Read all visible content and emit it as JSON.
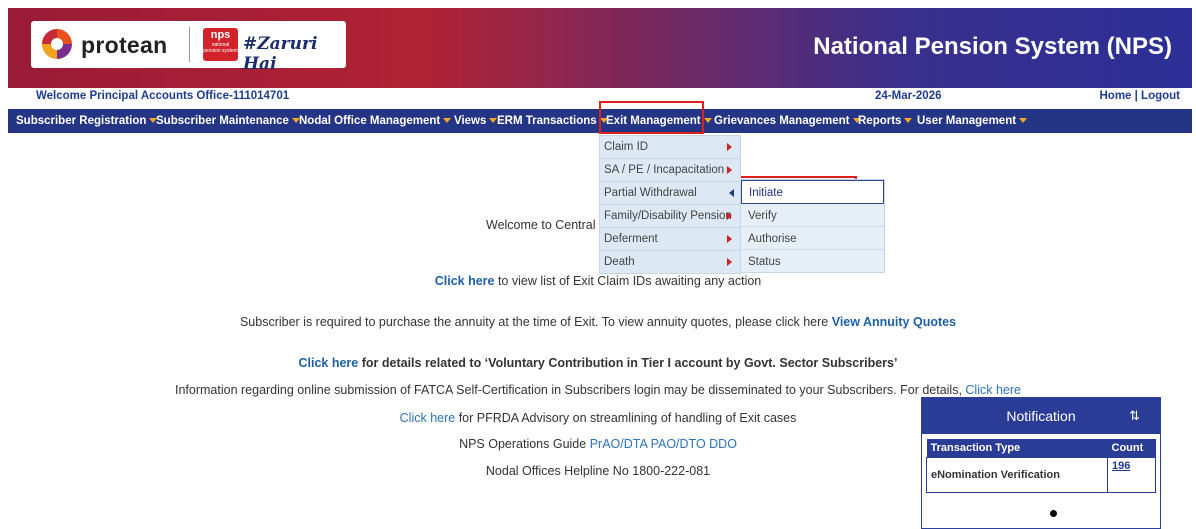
{
  "header": {
    "logo_text": "protean",
    "nps_badge": "nps",
    "nps_badge_small": "national pension system",
    "tagline": "#Zaruri Hai",
    "site_title": "National Pension System (NPS)"
  },
  "welcome": {
    "text": "Welcome Principal Accounts Office-111014701",
    "date": "24-Mar-2026",
    "home": "Home",
    "separator": " | ",
    "logout": "Logout"
  },
  "menu": [
    {
      "label": "Subscriber Registration"
    },
    {
      "label": "Subscriber Maintenance"
    },
    {
      "label": "Nodal Office Management"
    },
    {
      "label": "Views"
    },
    {
      "label": "ERM Transactions"
    },
    {
      "label": "Exit Management"
    },
    {
      "label": "Grievances Management"
    },
    {
      "label": "Reports"
    },
    {
      "label": "User Management"
    }
  ],
  "exit_dropdown": [
    {
      "label": "Claim ID"
    },
    {
      "label": "SA / PE / Incapacitation"
    },
    {
      "label": "Partial Withdrawal"
    },
    {
      "label": "Family/Disability Pension"
    },
    {
      "label": "Deferment"
    },
    {
      "label": "Death"
    }
  ],
  "partial_submenu": [
    {
      "label": "Initiate"
    },
    {
      "label": "Verify"
    },
    {
      "label": "Authorise"
    },
    {
      "label": "Status"
    }
  ],
  "content": {
    "welcome_partial": "Welcome to Central",
    "line1_link": "Click here",
    "line1_text": " to view list of Exit Claim IDs awaiting any action",
    "line2_text": "Subscriber is required to purchase the annuity at the time of Exit. To view annuity quotes, please click here ",
    "line2_link": "View Annuity Quotes",
    "line3_link": "Click here",
    "line3_text": " for details related to ‘Voluntary Contribution in Tier I account by Govt. Sector Subscribers’",
    "line4_text": "Information regarding online submission of FATCA Self-Certification in Subscribers login may be disseminated to your Subscribers. For details, ",
    "line4_link": "Click here",
    "line5_link": "Click here",
    "line5_text": " for PFRDA Advisory on streamlining of handling of Exit cases",
    "line6_text": "NPS Operations Guide ",
    "line6_link": "PrAO/DTA PAO/DTO DDO",
    "line7_text": "Nodal Offices Helpline No 1800-222-081"
  },
  "notification": {
    "title": "Notification",
    "sort_icon": "⇅",
    "col_type": "Transaction Type",
    "col_count": "Count",
    "rows": [
      {
        "type": "eNomination Verification",
        "count": "196"
      }
    ]
  },
  "colors": {
    "menu_bg": "#253585",
    "highlight": "#e0201f",
    "link": "#2a73b9"
  }
}
